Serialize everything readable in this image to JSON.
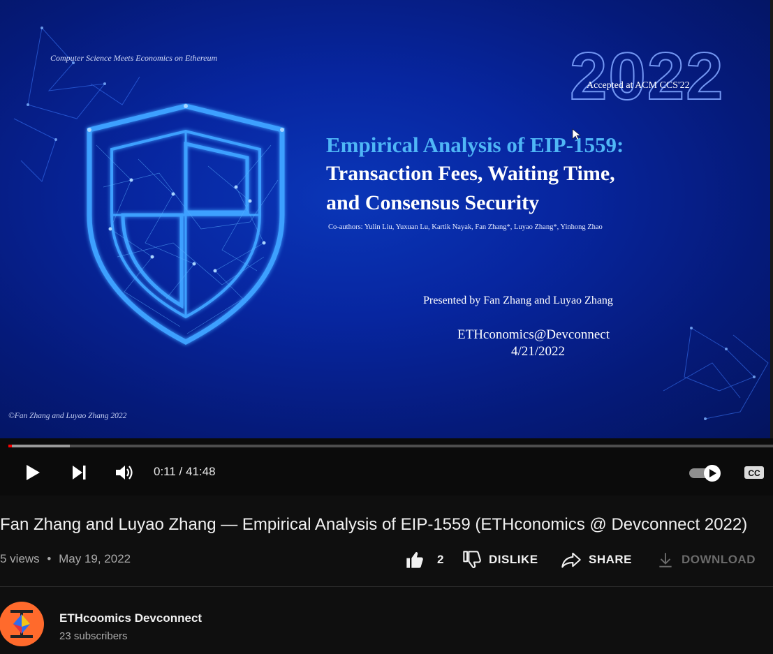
{
  "slide": {
    "header": "Computer Science Meets Economics on Ethereum",
    "year": "2022",
    "accepted": "Accepted at ACM CCS'22",
    "title_line1": "Empirical Analysis of EIP-1559:",
    "title_line2": "Transaction Fees, Waiting Time,",
    "title_line3": "and Consensus Security",
    "coauthors": "Co-authors: Yulin Liu, Yuxuan Lu, Kartik Nayak, Fan Zhang*, Luyao Zhang*, Yinhong Zhao",
    "presented_by": "Presented by Fan Zhang and Luyao Zhang",
    "event": "ETHconomics@Devconnect",
    "date": "4/21/2022",
    "footer": "©Fan Zhang and Luyao Zhang 2022"
  },
  "player": {
    "current_time": "0:11",
    "separator": " / ",
    "duration": "41:48",
    "played_fraction": 0.0044,
    "buffered_fraction": 0.08,
    "icons": {
      "play": "play-icon",
      "next": "next-icon",
      "volume": "volume-icon",
      "autoplay": "autoplay-toggle-icon",
      "captions": "cc-icon"
    },
    "captions_label": "CC"
  },
  "video": {
    "title": "Fan Zhang and Luyao Zhang — Empirical Analysis of EIP-1559 (ETHconomics @ Devconnect 2022)",
    "views": "5 views",
    "dot": "•",
    "date": "May 19, 2022"
  },
  "actions": {
    "like_count": "2",
    "dislike_label": "DISLIKE",
    "share_label": "SHARE",
    "download_label": "DOWNLOAD"
  },
  "channel": {
    "name": "ETHcoomics Devconnect",
    "subscribers": "23 subscribers"
  },
  "colors": {
    "background": "#0f0f0f",
    "slide_blue": "#0726a0",
    "title_accent": "#4fb6f6",
    "progress_red": "#ff0000",
    "avatar_orange": "#ff6a2c"
  }
}
